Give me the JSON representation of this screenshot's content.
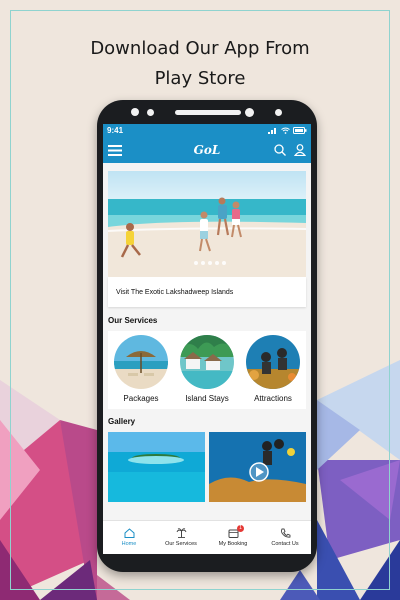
{
  "promo": {
    "line1": "Download Our App From",
    "line2": "Play Store"
  },
  "status_bar": {
    "time": "9:41"
  },
  "header": {
    "logo_text": "GoL",
    "menu_icon": "hamburger-icon",
    "search_icon": "search-icon",
    "profile_icon": "user-icon"
  },
  "hero": {
    "caption": "Visit The Exotic Lakshadweep Islands",
    "slides_count": 5
  },
  "services": {
    "title": "Our Services",
    "items": [
      {
        "label": "Packages",
        "icon": "beach-umbrella-image"
      },
      {
        "label": "Island Stays",
        "icon": "island-huts-image"
      },
      {
        "label": "Attractions",
        "icon": "diving-image"
      }
    ]
  },
  "gallery": {
    "title": "Gallery"
  },
  "bottom_nav": {
    "items": [
      {
        "label": "Home",
        "icon": "home-icon",
        "active": true
      },
      {
        "label": "Our Services",
        "icon": "palm-tree-icon",
        "active": false
      },
      {
        "label": "My Booking",
        "icon": "booking-icon",
        "active": false,
        "badge": "1"
      },
      {
        "label": "Contact Us",
        "icon": "phone-icon",
        "active": false
      }
    ]
  },
  "colors": {
    "brand": "#1b8fc6",
    "page_bg": "#efe6dd",
    "badge": "#e53935"
  }
}
